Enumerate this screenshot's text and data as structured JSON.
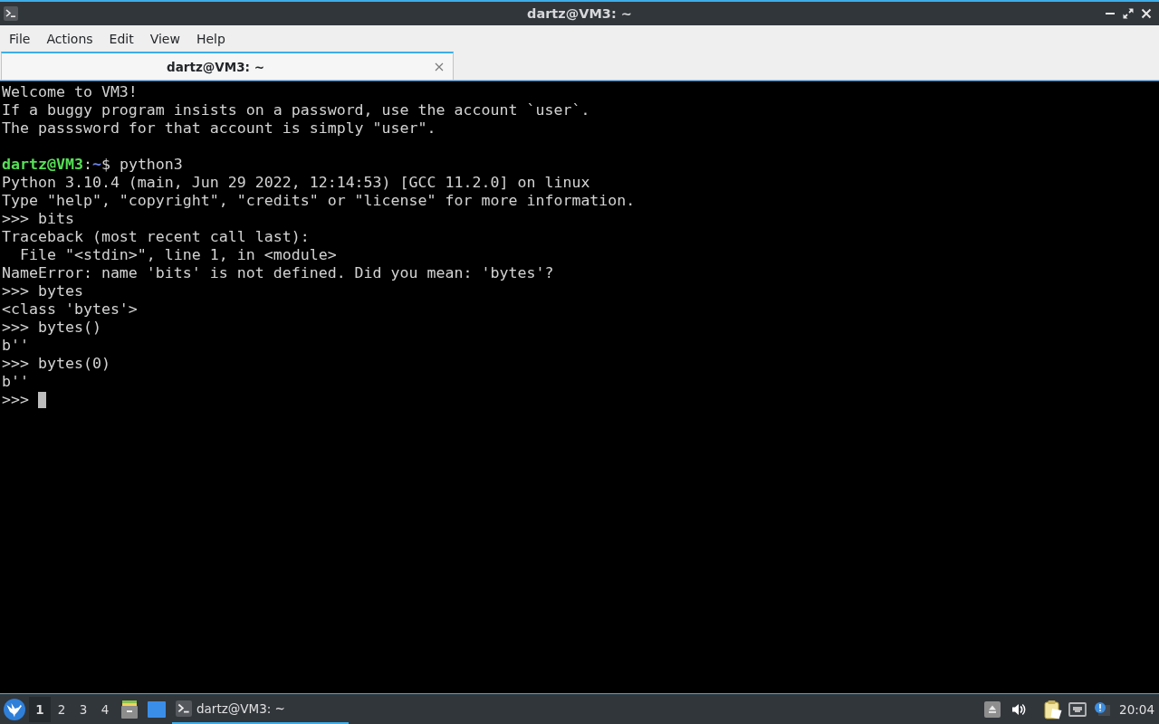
{
  "window": {
    "title": "dartz@VM3: ~"
  },
  "menu_bar": {
    "items": [
      "File",
      "Actions",
      "Edit",
      "View",
      "Help"
    ]
  },
  "tabs": [
    {
      "label": "dartz@VM3: ~",
      "selected": true
    }
  ],
  "terminal": {
    "lines": [
      {
        "kind": "text",
        "text": "Welcome to VM3!"
      },
      {
        "kind": "text",
        "text": "If a buggy program insists on a password, use the account `user`."
      },
      {
        "kind": "text",
        "text": "The passsword for that account is simply \"user\"."
      },
      {
        "kind": "blank"
      },
      {
        "kind": "prompt",
        "segments": [
          {
            "kind": "user_host",
            "text": "dartz@VM3"
          },
          {
            "kind": "plain",
            "text": ":"
          },
          {
            "kind": "path",
            "text": "~"
          },
          {
            "kind": "plain",
            "text": "$ python3"
          }
        ]
      },
      {
        "kind": "text",
        "text": "Python 3.10.4 (main, Jun 29 2022, 12:14:53) [GCC 11.2.0] on linux"
      },
      {
        "kind": "text",
        "text": "Type \"help\", \"copyright\", \"credits\" or \"license\" for more information."
      },
      {
        "kind": "text",
        "text": ">>> bits"
      },
      {
        "kind": "text",
        "text": "Traceback (most recent call last):"
      },
      {
        "kind": "indented",
        "text": "File \"<stdin>\", line 1, in <module>"
      },
      {
        "kind": "text",
        "text": "NameError: name 'bits' is not defined. Did you mean: 'bytes'?"
      },
      {
        "kind": "text",
        "text": ">>> bytes"
      },
      {
        "kind": "text",
        "text": "<class 'bytes'>"
      },
      {
        "kind": "text",
        "text": ">>> bytes()"
      },
      {
        "kind": "text",
        "text": "b''"
      },
      {
        "kind": "text",
        "text": ">>> bytes(0)"
      },
      {
        "kind": "text",
        "text": "b''"
      },
      {
        "kind": "input",
        "text": ">>>",
        "cursor": true
      }
    ]
  },
  "taskbar": {
    "desktops": [
      {
        "label": "1",
        "selected": true
      },
      {
        "label": "2",
        "selected": false
      },
      {
        "label": "3",
        "selected": false
      },
      {
        "label": "4",
        "selected": false
      }
    ],
    "tasks": [
      {
        "label": "dartz@VM3: ~",
        "selected": true
      }
    ],
    "clock": "20:04"
  }
}
